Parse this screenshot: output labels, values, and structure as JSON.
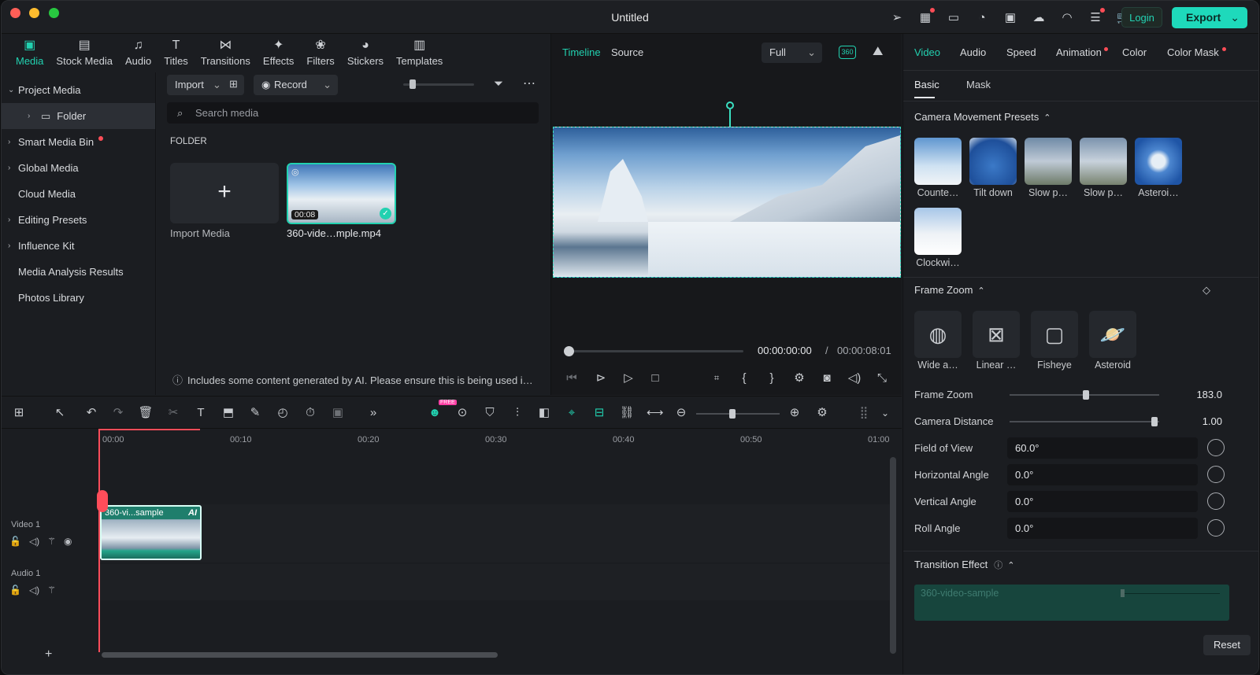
{
  "window": {
    "title": "Untitled"
  },
  "header": {
    "login": "Login",
    "export": "Export"
  },
  "toptabs": [
    {
      "label": "Media",
      "icon": "media-icon"
    },
    {
      "label": "Stock Media",
      "icon": "stock-media-icon"
    },
    {
      "label": "Audio",
      "icon": "music-note-icon"
    },
    {
      "label": "Titles",
      "icon": "titles-icon"
    },
    {
      "label": "Transitions",
      "icon": "transitions-icon"
    },
    {
      "label": "Effects",
      "icon": "effects-icon"
    },
    {
      "label": "Filters",
      "icon": "filters-icon"
    },
    {
      "label": "Stickers",
      "icon": "stickers-icon"
    },
    {
      "label": "Templates",
      "icon": "templates-icon"
    }
  ],
  "sidebar": {
    "items": [
      {
        "label": "Project Media"
      },
      {
        "label": "Folder"
      },
      {
        "label": "Smart Media Bin"
      },
      {
        "label": "Global Media"
      },
      {
        "label": "Cloud Media"
      },
      {
        "label": "Editing Presets"
      },
      {
        "label": "Influence Kit"
      },
      {
        "label": "Media Analysis Results"
      },
      {
        "label": "Photos Library"
      }
    ]
  },
  "media": {
    "import": "Import",
    "record": "Record",
    "search_placeholder": "Search media",
    "folder_heading": "FOLDER",
    "import_media": "Import Media",
    "clip_name": "360-vide…mple.mp4",
    "clip_duration": "00:08",
    "ai_notice": "Includes some content generated by AI. Please ensure this is being used i…"
  },
  "viewer": {
    "tab_timeline": "Timeline",
    "tab_source": "Source",
    "quality": "Full",
    "badge360": "360",
    "time_current": "00:00:00:00",
    "time_sep": "/",
    "time_total": "00:00:08:01"
  },
  "right": {
    "tabs": {
      "video": "Video",
      "audio": "Audio",
      "speed": "Speed",
      "animation": "Animation",
      "color": "Color",
      "color_mask": "Color Mask"
    },
    "subtabs": {
      "basic": "Basic",
      "mask": "Mask"
    },
    "camera_presets_title": "Camera Movement Presets",
    "presets": [
      "Counte…",
      "Tilt down",
      "Slow p…",
      "Slow p…",
      "Asteroi…",
      "Clockwi…"
    ],
    "frame_zoom_title": "Frame Zoom",
    "zoom_types": [
      "Wide a…",
      "Linear …",
      "Fisheye",
      "Asteroid"
    ],
    "sliders": {
      "frame_zoom_label": "Frame Zoom",
      "frame_zoom_value": "183.0",
      "frame_zoom_level": 0.51,
      "camera_distance_label": "Camera Distance",
      "camera_distance_value": "1.00",
      "camera_distance_level": 0.97
    },
    "fields": {
      "fov_label": "Field of View",
      "fov": "60.0°",
      "h_label": "Horizontal Angle",
      "h": "0.0°",
      "v_label": "Vertical Angle",
      "v": "0.0°",
      "roll_label": "Roll Angle",
      "roll": "0.0°"
    },
    "transition_title": "Transition Effect",
    "transition_clip": "360-video-sample",
    "reset": "Reset"
  },
  "timeline": {
    "ticks": [
      "00:00",
      "00:10",
      "00:20",
      "00:30",
      "00:40",
      "00:50",
      "01:00"
    ],
    "video_track": "Video 1",
    "audio_track": "Audio 1",
    "clip_label": "360-vi...sample",
    "clip_ai": "AI",
    "free_badge": "FREE"
  },
  "colors": {
    "accent": "#22d1b0",
    "export_bg": "#1ed9bb",
    "playhead": "#ff4d5a"
  }
}
